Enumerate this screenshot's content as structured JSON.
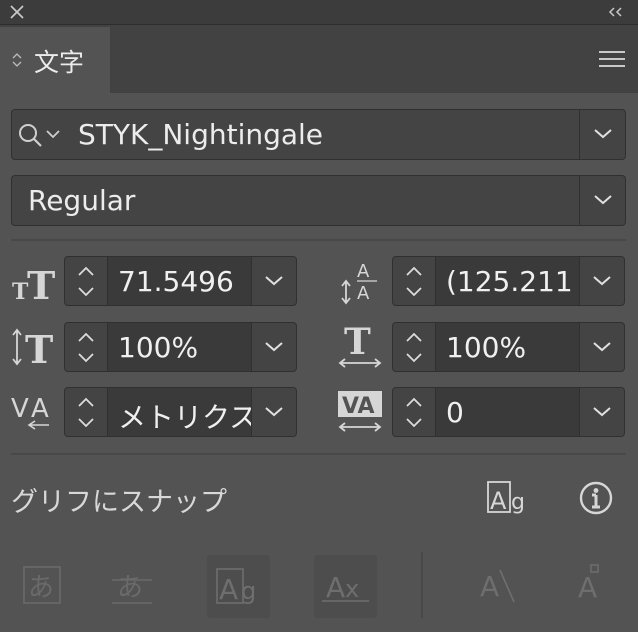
{
  "window": {
    "close_icon": "close-icon",
    "collapse_icon": "double-chevron-left-icon"
  },
  "tab": {
    "label": "文字",
    "menu_icon": "hamburger-menu-icon"
  },
  "font_family": {
    "value": "STYK_Nightingale",
    "icons": [
      "search-icon",
      "chevron-down-icon"
    ]
  },
  "font_style": {
    "value": "Regular"
  },
  "size": {
    "value": "71.5496"
  },
  "leading": {
    "value": "(125.211"
  },
  "vertical_scale": {
    "value": "100%"
  },
  "horizontal_scale": {
    "value": "100%"
  },
  "kerning": {
    "value": "メトリクス"
  },
  "tracking": {
    "value": "0"
  },
  "snap": {
    "label": "グリフにスナップ",
    "icons": [
      "glyph-bounds-icon",
      "info-icon"
    ]
  },
  "snap_options": {
    "icons": [
      "baseline-snap-icon",
      "x-height-snap-icon",
      "glyph-bounds-snap-icon",
      "proximity-guides-icon",
      "angle-guides-icon",
      "anchor-point-icon"
    ]
  },
  "colors": {
    "panel": "#535353",
    "field": "#444444",
    "text": "#ececec"
  }
}
